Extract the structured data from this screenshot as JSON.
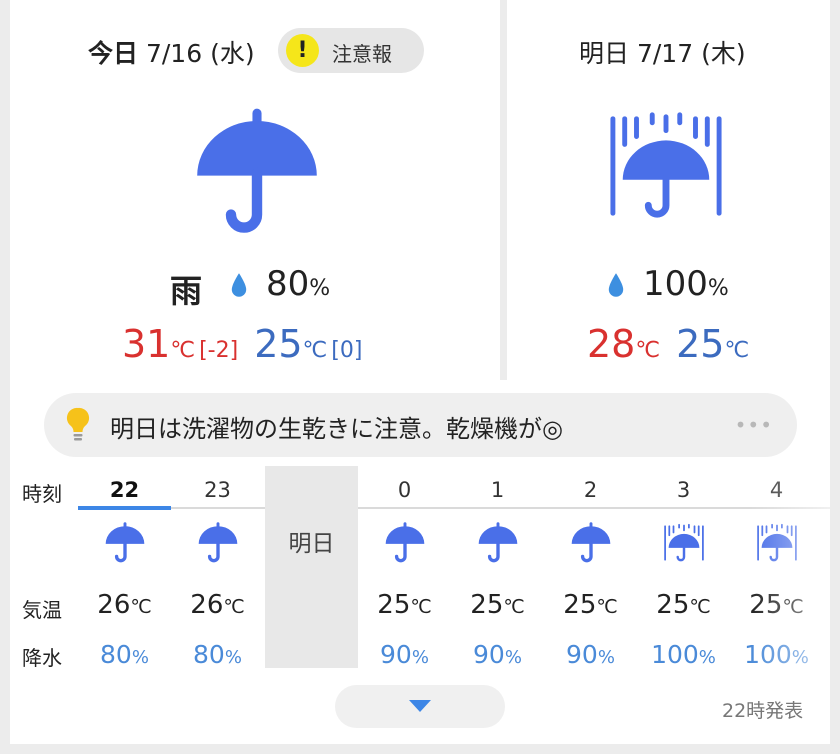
{
  "today": {
    "label": "今日",
    "date": "7/16",
    "weekday": "(水)",
    "warning": {
      "label": "注意報",
      "icon": "exclamation-icon",
      "symbol": "!"
    },
    "weather_icon": "umbrella-icon",
    "weather": "雨",
    "pop_value": "80",
    "pop_unit": "%",
    "max_temp": "31",
    "max_diff": "[-2]",
    "min_temp": "25",
    "min_diff": "[0]",
    "temp_unit": "℃"
  },
  "tomorrow": {
    "label": "明日",
    "date": "7/17",
    "weekday": "(木)",
    "weather_icon": "heavy-rain-umbrella-icon",
    "pop_value": "100",
    "pop_unit": "%",
    "max_temp": "28",
    "min_temp": "25",
    "temp_unit": "℃"
  },
  "advice": {
    "icon": "lightbulb-icon",
    "text": "明日は洗濯物の生乾きに注意。乾燥機が◎",
    "more": "•••"
  },
  "hourly": {
    "row_labels": {
      "time": "時刻",
      "temp": "気温",
      "precip": "降水"
    },
    "tomorrow_label": "明日",
    "temp_unit": "℃",
    "pop_unit": "%",
    "hours": [
      {
        "hour": "22",
        "icon": "umbrella-icon",
        "temp": "26",
        "pop": "80",
        "active": true
      },
      {
        "hour": "23",
        "icon": "umbrella-icon",
        "temp": "26",
        "pop": "80"
      },
      {
        "hour": "0",
        "icon": "umbrella-icon",
        "temp": "25",
        "pop": "90"
      },
      {
        "hour": "1",
        "icon": "umbrella-icon",
        "temp": "25",
        "pop": "90"
      },
      {
        "hour": "2",
        "icon": "umbrella-icon",
        "temp": "25",
        "pop": "90"
      },
      {
        "hour": "3",
        "icon": "heavy-rain-umbrella-icon",
        "temp": "25",
        "pop": "100"
      },
      {
        "hour": "4",
        "icon": "heavy-rain-umbrella-icon",
        "temp": "25",
        "pop": "100"
      }
    ]
  },
  "footer": {
    "issued": "22時発表",
    "expand_icon": "chevron-down-icon"
  },
  "colors": {
    "icon_blue": "#4a6fe8",
    "max_red": "#d9312f",
    "min_blue": "#3c6bbf",
    "pop_blue": "#4a8ad8",
    "active_tab": "#3d86e6",
    "warning_yellow": "#f5e61a"
  }
}
